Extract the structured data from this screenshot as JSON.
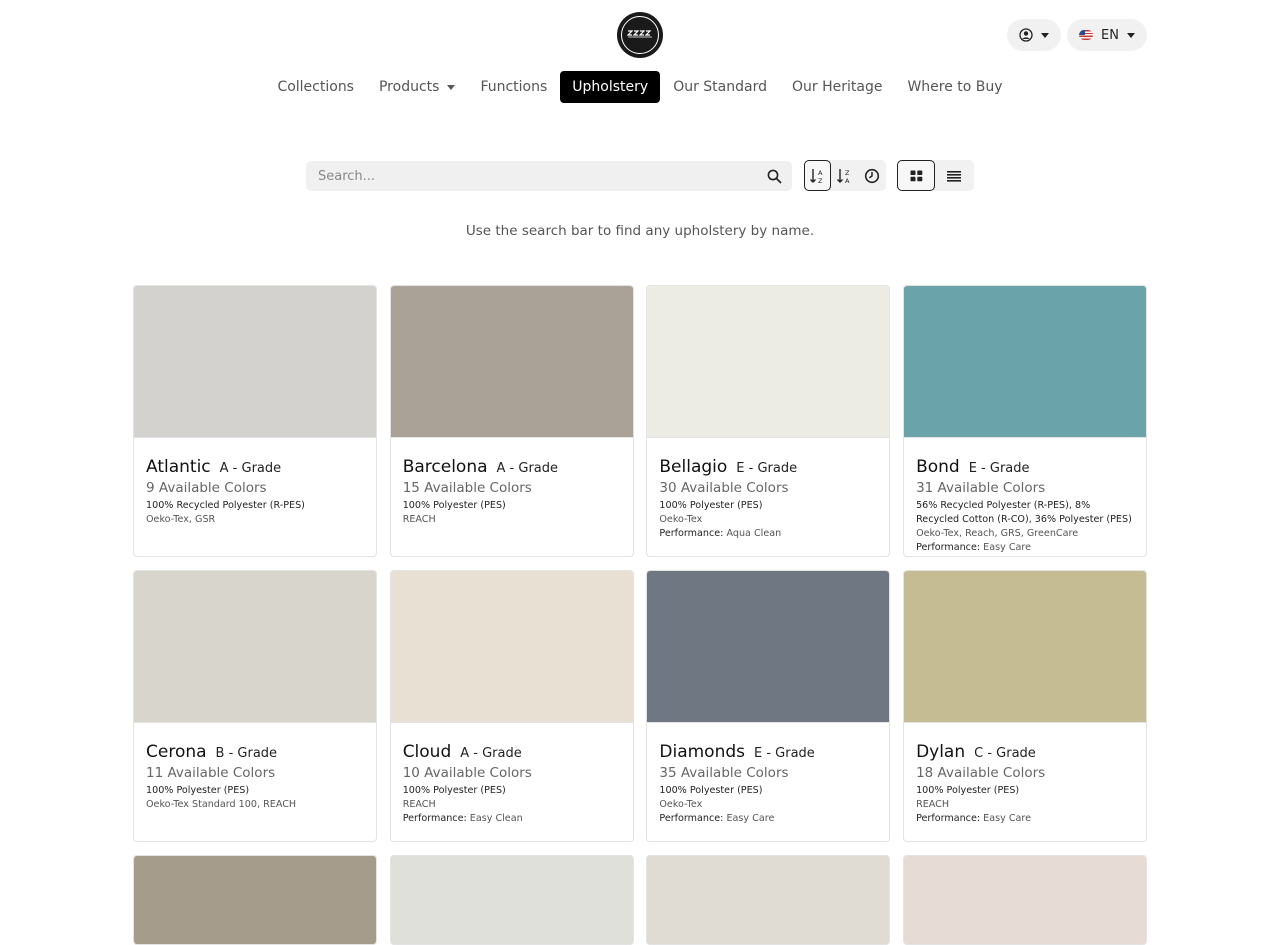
{
  "language": {
    "label": "EN"
  },
  "nav": {
    "items": [
      {
        "label": "Collections",
        "active": false,
        "dropdown": false
      },
      {
        "label": "Products",
        "active": false,
        "dropdown": true
      },
      {
        "label": "Functions",
        "active": false,
        "dropdown": false
      },
      {
        "label": "Upholstery",
        "active": true,
        "dropdown": false
      },
      {
        "label": "Our Standard",
        "active": false,
        "dropdown": false
      },
      {
        "label": "Our Heritage",
        "active": false,
        "dropdown": false
      },
      {
        "label": "Where to Buy",
        "active": false,
        "dropdown": false
      }
    ]
  },
  "search": {
    "placeholder": "Search..."
  },
  "hint": "Use the search bar to find any upholstery by name.",
  "performance_label": "Performance:",
  "cards": [
    {
      "name": "Atlantic",
      "grade": "A - Grade",
      "colors": "9 Available Colors",
      "composition": "100% Recycled Polyester (R-PES)",
      "certs": "Oeko-Tex, GSR",
      "performance": "",
      "swatch_color": "#d3d2cf"
    },
    {
      "name": "Barcelona",
      "grade": "A - Grade",
      "colors": "15 Available Colors",
      "composition": "100% Polyester (PES)",
      "certs": "REACH",
      "performance": "",
      "swatch_color": "#aba297"
    },
    {
      "name": "Bellagio",
      "grade": "E - Grade",
      "colors": "30 Available Colors",
      "composition": "100% Polyester (PES)",
      "certs": "Oeko-Tex",
      "performance": "Aqua Clean",
      "swatch_color": "#ecebe4"
    },
    {
      "name": "Bond",
      "grade": "E - Grade",
      "colors": "31 Available Colors",
      "composition": "56% Recycled Polyester (R-PES), 8% Recycled Cotton (R-CO), 36% Polyester (PES)",
      "certs": "Oeko-Tex, Reach, GRS, GreenCare",
      "performance": "Easy Care",
      "swatch_color": "#6aa3aa"
    },
    {
      "name": "Cerona",
      "grade": "B - Grade",
      "colors": "11 Available Colors",
      "composition": "100% Polyester (PES)",
      "certs": "Oeko-Tex Standard 100, REACH",
      "performance": "",
      "swatch_color": "#d8d5cc"
    },
    {
      "name": "Cloud",
      "grade": "A - Grade",
      "colors": "10 Available Colors",
      "composition": "100% Polyester (PES)",
      "certs": "REACH",
      "performance": "Easy Clean",
      "swatch_color": "#e7e0d3"
    },
    {
      "name": "Diamonds",
      "grade": "E - Grade",
      "colors": "35 Available Colors",
      "composition": "100% Polyester (PES)",
      "certs": "Oeko-Tex",
      "performance": "Easy Care",
      "swatch_color": "#6f7782"
    },
    {
      "name": "Dylan",
      "grade": "C - Grade",
      "colors": "18 Available Colors",
      "composition": "100% Polyester (PES)",
      "certs": "REACH",
      "performance": "Easy Care",
      "swatch_color": "#c6bc93"
    }
  ],
  "partial_swatches": [
    "#a69c8c",
    "#dfe0da",
    "#e0dcd3",
    "#e7dcd5"
  ]
}
